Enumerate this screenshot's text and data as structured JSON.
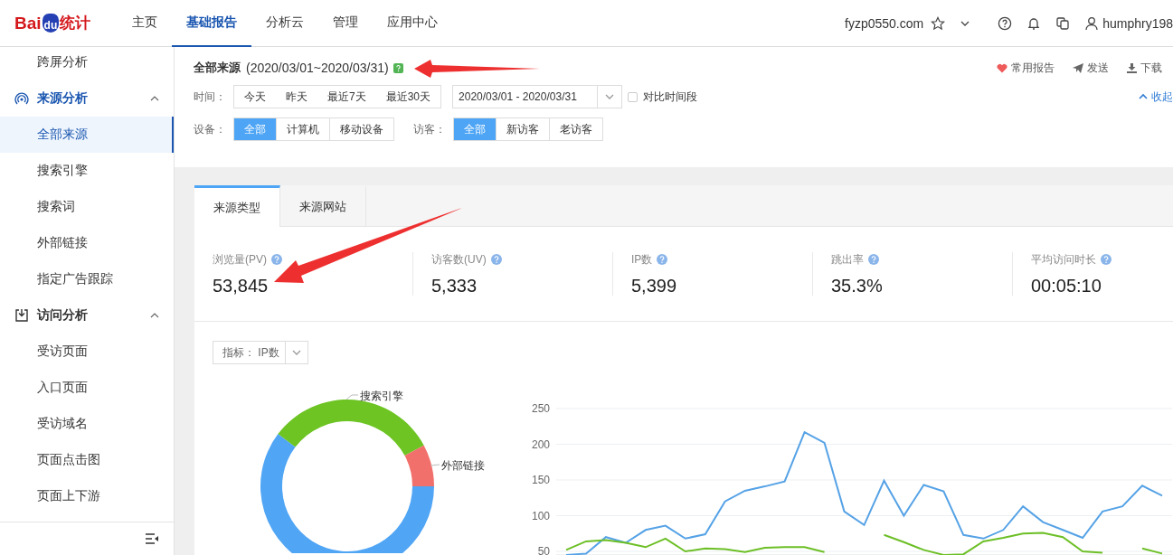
{
  "header": {
    "logo": {
      "part_1": "Bai",
      "part_2": "du",
      "part_3": "统计"
    },
    "nav": [
      {
        "label": "主页",
        "selected": false
      },
      {
        "label": "基础报告",
        "selected": true
      },
      {
        "label": "分析云",
        "selected": false
      },
      {
        "label": "管理",
        "selected": false
      },
      {
        "label": "应用中心",
        "selected": false
      }
    ],
    "site": "fyzp0550.com",
    "user": "humphry198"
  },
  "sidebar": {
    "items": [
      {
        "kind": "item",
        "label": "跨屏分析",
        "selected": false
      },
      {
        "kind": "group",
        "label": "来源分析",
        "expanded": true
      },
      {
        "kind": "item",
        "label": "全部来源",
        "selected": true
      },
      {
        "kind": "item",
        "label": "搜索引擎",
        "selected": false
      },
      {
        "kind": "item",
        "label": "搜索词",
        "selected": false
      },
      {
        "kind": "item",
        "label": "外部链接",
        "selected": false
      },
      {
        "kind": "item",
        "label": "指定广告跟踪",
        "selected": false
      },
      {
        "kind": "group",
        "label": "访问分析",
        "expanded": true
      },
      {
        "kind": "item",
        "label": "受访页面",
        "selected": false
      },
      {
        "kind": "item",
        "label": "入口页面",
        "selected": false
      },
      {
        "kind": "item",
        "label": "受访域名",
        "selected": false
      },
      {
        "kind": "item",
        "label": "页面点击图",
        "selected": false
      },
      {
        "kind": "item",
        "label": "页面上下游",
        "selected": false
      }
    ]
  },
  "report": {
    "title": "全部来源",
    "range": "(2020/03/01~2020/03/31)",
    "actions": [
      {
        "kind": "favorite",
        "label": "常用报告"
      },
      {
        "kind": "send",
        "label": "发送"
      },
      {
        "kind": "download",
        "label": "下载"
      }
    ],
    "time": {
      "label": "时间：",
      "options": [
        "今天",
        "昨天",
        "最近7天",
        "最近30天"
      ],
      "date_range": "2020/03/01 - 2020/03/31",
      "compare": {
        "label": "对比时间段",
        "checked": false
      },
      "collapse": "收起"
    },
    "device": {
      "label": "设备：",
      "options": [
        {
          "label": "全部",
          "selected": true
        },
        {
          "label": "计算机",
          "selected": false
        },
        {
          "label": "移动设备",
          "selected": false
        }
      ]
    },
    "visitor": {
      "label": "访客：",
      "options": [
        {
          "label": "全部",
          "selected": true
        },
        {
          "label": "新访客",
          "selected": false
        },
        {
          "label": "老访客",
          "selected": false
        }
      ]
    }
  },
  "card": {
    "tabs": [
      {
        "label": "来源类型",
        "selected": true
      },
      {
        "label": "来源网站",
        "selected": false
      }
    ],
    "metrics": [
      {
        "label": "浏览量(PV)",
        "value": "53,845"
      },
      {
        "label": "访客数(UV)",
        "value": "5,333"
      },
      {
        "label": "IP数",
        "value": "5,399"
      },
      {
        "label": "跳出率",
        "value": "35.3%"
      },
      {
        "label": "平均访问时长",
        "value": "00:05:10"
      }
    ],
    "indicator": {
      "label": "指标：",
      "value": "IP数"
    },
    "donut": {
      "segments": [
        {
          "color": "#50a5f5"
        },
        {
          "color": "#6dc423",
          "label": "搜索引擎"
        },
        {
          "color": "#f2706b",
          "label": "外部链接"
        }
      ]
    },
    "chart_data": {
      "type": "line",
      "grid": true,
      "ylim": [
        45,
        250
      ],
      "yticks": [
        50,
        100,
        150,
        200,
        250
      ],
      "series": [
        {
          "color": "#55a2e6",
          "values": [
            45,
            47,
            70,
            62,
            80,
            86,
            68,
            74,
            120,
            135,
            141,
            148,
            217,
            202,
            106,
            87,
            149,
            100,
            143,
            134,
            73,
            68,
            80,
            113,
            91,
            80,
            69,
            106,
            113,
            142,
            128
          ]
        },
        {
          "color": "#6cbf26",
          "values": [
            52,
            64,
            66,
            62,
            56,
            68,
            50,
            54,
            53,
            49,
            55,
            56,
            56,
            49,
            null,
            null,
            73,
            63,
            52,
            45,
            46,
            64,
            69,
            75,
            76,
            70,
            50,
            48,
            null,
            54,
            47
          ]
        }
      ]
    }
  }
}
